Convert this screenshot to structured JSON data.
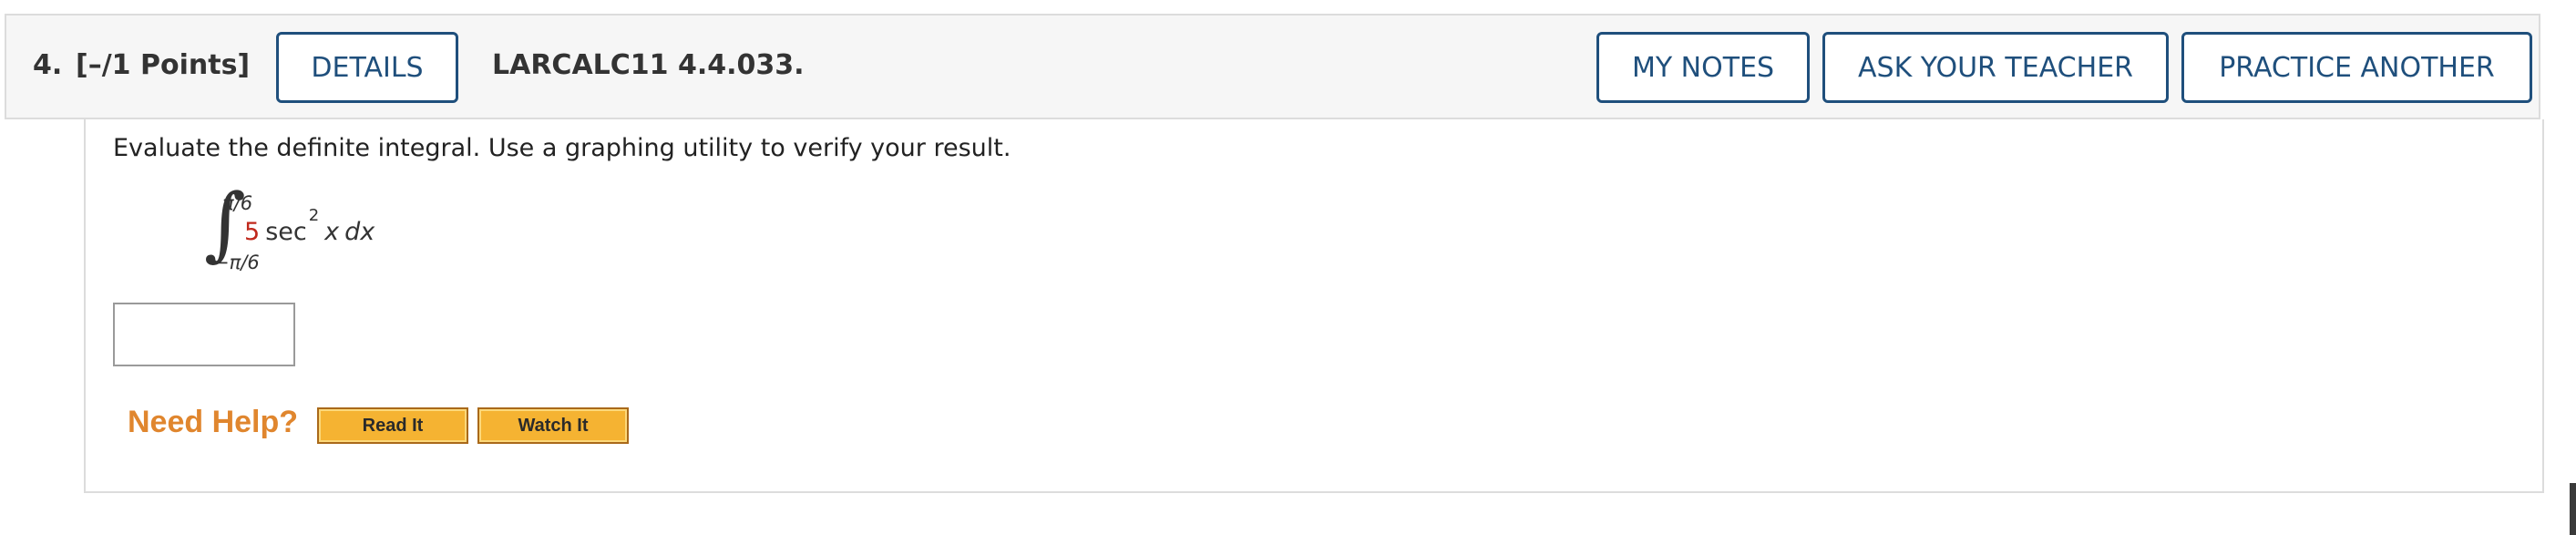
{
  "question": {
    "number": "4.",
    "points": "[–/1 Points]",
    "code": "LARCALC11 4.4.033."
  },
  "buttons": {
    "details": "DETAILS",
    "my_notes": "MY NOTES",
    "ask_teacher": "ASK YOUR TEACHER",
    "practice_another": "PRACTICE ANOTHER"
  },
  "body": {
    "prompt": "Evaluate the definite integral. Use a graphing utility to verify your result."
  },
  "integral": {
    "sign": "∫",
    "upper": "π/6",
    "lower": "−π/6",
    "coefficient": "5",
    "function": "sec",
    "exponent": "2",
    "variable": "x",
    "differential": "dx"
  },
  "answer": {
    "value": ""
  },
  "help": {
    "label": "Need Help?",
    "read_it": "Read It",
    "watch_it": "Watch It"
  },
  "colors": {
    "accent": "#1f4f7c",
    "coefficient": "#c0281c",
    "help_label": "#e0862e",
    "help_button": "#f5b332"
  }
}
